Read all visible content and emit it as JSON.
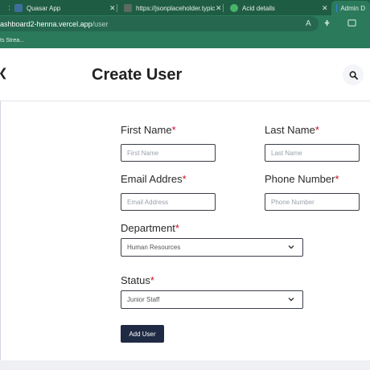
{
  "browser": {
    "tabs": [
      {
        "label": "Quasar App"
      },
      {
        "label": "https://jsonplaceholder.typic"
      },
      {
        "label": "Acid details"
      },
      {
        "label": "Admin D"
      }
    ],
    "url_host": "ashboard2-henna.vercel.app",
    "url_path": "/user",
    "bookmark": "ts Strea..."
  },
  "header": {
    "title": "Create User"
  },
  "form": {
    "first_name": {
      "label": "First Name",
      "required": "*",
      "placeholder": "First Name"
    },
    "last_name": {
      "label": "Last Name",
      "required": "*",
      "placeholder": "Last Name"
    },
    "email": {
      "label": "Email Addres",
      "required": "*",
      "placeholder": "Email Address"
    },
    "phone": {
      "label": "Phone Number",
      "required": "*",
      "placeholder": "Phone Number"
    },
    "department": {
      "label": "Department",
      "required": "*",
      "selected": "Human Resources"
    },
    "status": {
      "label": "Status",
      "required": "*",
      "selected": "Junior Staff"
    },
    "submit_label": "Add User"
  },
  "colors": {
    "browser_frame": "#2b7a5c",
    "required": "#c0132d",
    "button": "#1f2a44"
  }
}
